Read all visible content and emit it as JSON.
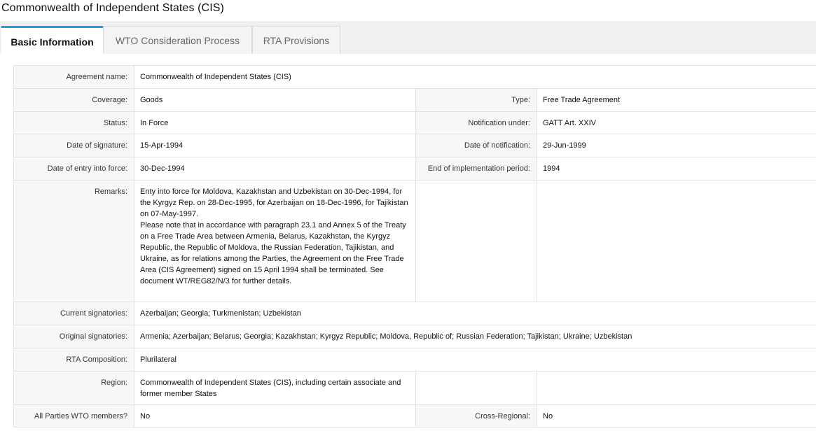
{
  "page": {
    "title": "Commonwealth of Independent States (CIS)"
  },
  "tabs": [
    {
      "label": "Basic Information",
      "active": true
    },
    {
      "label": "WTO Consideration Process",
      "active": false
    },
    {
      "label": "RTA Provisions",
      "active": false
    }
  ],
  "fields": {
    "agreement_name": {
      "label": "Agreement name:",
      "value": "Commonwealth of Independent States (CIS)"
    },
    "coverage": {
      "label": "Coverage:",
      "value": "Goods"
    },
    "type": {
      "label": "Type:",
      "value": "Free Trade Agreement"
    },
    "status": {
      "label": "Status:",
      "value": "In Force"
    },
    "notification_under": {
      "label": "Notification under:",
      "value": "GATT Art. XXIV"
    },
    "date_of_signature": {
      "label": "Date of signature:",
      "value": "15-Apr-1994"
    },
    "date_of_notification": {
      "label": "Date of notification:",
      "value": "29-Jun-1999"
    },
    "date_of_entry": {
      "label": "Date of entry into force:",
      "value": "30-Dec-1994"
    },
    "end_of_implementation": {
      "label": "End of implementation period:",
      "value": "1994"
    },
    "remarks": {
      "label": "Remarks:",
      "value": "Enty into force for Moldova, Kazakhstan and Uzbekistan on 30-Dec-1994, for the Kyrgyz Rep. on 28-Dec-1995, for Azerbaijan on 18-Dec-1996, for Tajikistan on 07-May-1997.\nPlease note that in accordance with paragraph 23.1 and Annex 5 of the Treaty on a Free Trade Area between Armenia, Belarus, Kazakhstan, the Kyrgyz Republic, the Republic of Moldova, the Russian Federation, Tajikistan, and Ukraine,  as for relations among the Parties, the Agreement on the Free Trade Area (CIS Agreement) signed on 15 April 1994  shall be terminated. See document WT/REG82/N/3 for further details."
    },
    "current_signatories": {
      "label": "Current signatories:",
      "value": "Azerbaijan; Georgia; Turkmenistan; Uzbekistan"
    },
    "original_signatories": {
      "label": "Original signatories:",
      "value": "Armenia; Azerbaijan; Belarus; Georgia; Kazakhstan; Kyrgyz Republic; Moldova, Republic of; Russian Federation; Tajikistan; Ukraine; Uzbekistan"
    },
    "rta_composition": {
      "label": "RTA Composition:",
      "value": "Plurilateral"
    },
    "region": {
      "label": "Region:",
      "value": "Commonwealth of Independent States (CIS), including certain associate and former member States"
    },
    "all_parties_wto": {
      "label": "All Parties WTO members?",
      "value": "No"
    },
    "cross_regional": {
      "label": "Cross-Regional:",
      "value": "No"
    }
  }
}
